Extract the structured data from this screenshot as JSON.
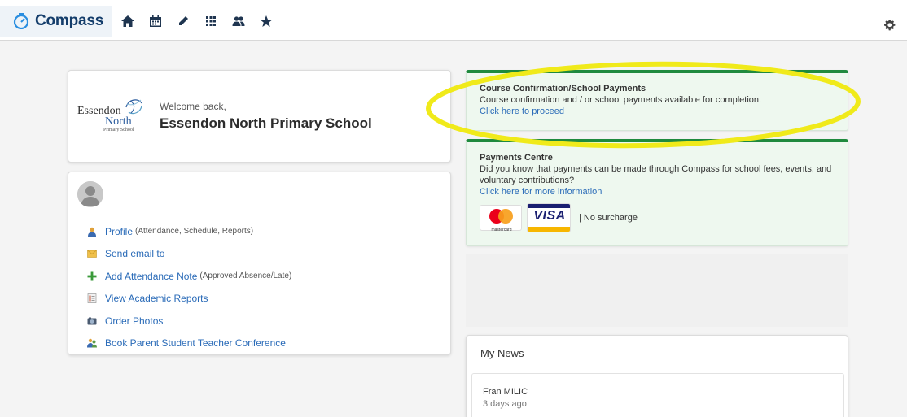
{
  "app": {
    "brand": "Compass",
    "brand_icon": "compass-logo-icon",
    "nav_items": [
      {
        "name": "home",
        "icon": "home-icon"
      },
      {
        "name": "calendar",
        "icon": "calendar-icon"
      },
      {
        "name": "edit",
        "icon": "pencil-icon"
      },
      {
        "name": "apps",
        "icon": "grid-icon"
      },
      {
        "name": "people",
        "icon": "people-icon"
      },
      {
        "name": "favourites",
        "icon": "star-icon"
      }
    ],
    "settings_icon": "gear-icon"
  },
  "school_card": {
    "logo_main": "Essendon",
    "logo_north": "North",
    "logo_sub": "Primary School",
    "welcome": "Welcome back,",
    "school_name": "Essendon North Primary School"
  },
  "student_card": {
    "links": [
      {
        "label": "Profile",
        "note": "(Attendance, Schedule, Reports)",
        "icon": "person-icon"
      },
      {
        "label": "Send email to",
        "note": "",
        "icon": "envelope-icon"
      },
      {
        "label": "Add Attendance Note",
        "note": "(Approved Absence/Late)",
        "icon": "plus-icon"
      },
      {
        "label": "View Academic Reports",
        "note": "",
        "icon": "report-icon"
      },
      {
        "label": "Order Photos",
        "note": "",
        "icon": "camera-icon"
      },
      {
        "label": "Book Parent Student Teacher Conference",
        "note": "",
        "icon": "conference-icon"
      }
    ]
  },
  "course_notice": {
    "title": "Course Confirmation/School Payments",
    "text": "Course confirmation and / or school payments available for completion.",
    "link": "Click here to proceed"
  },
  "payments_notice": {
    "title": "Payments Centre",
    "text": "Did you know that payments can be made through Compass for school fees, events, and voluntary contributions?",
    "link": "Click here for more information",
    "mastercard_label": "mastercard",
    "visa_label": "VISA",
    "surcharge": "|   No surcharge"
  },
  "news": {
    "title": "My News",
    "items": [
      {
        "author": "Fran MILIC",
        "time": "3 days ago"
      }
    ]
  },
  "colors": {
    "brand": "#143d6b",
    "link": "#2a6bb8",
    "notice_border": "#1f8a3e",
    "notice_bg": "#eef8ef",
    "annotation": "#f0ea1a"
  }
}
